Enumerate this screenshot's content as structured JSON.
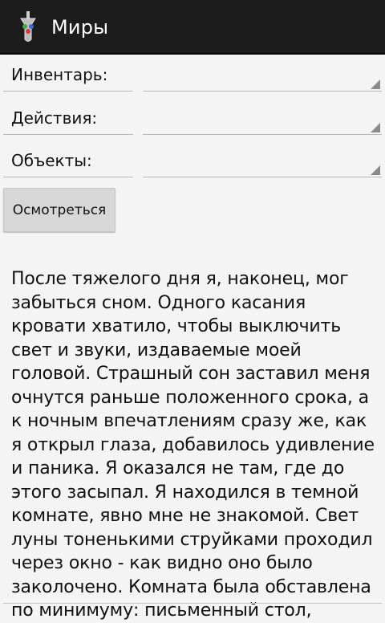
{
  "actionbar": {
    "title": "Миры",
    "icon": "app-potion-icon"
  },
  "controls": {
    "inventory_label": "Инвентарь:",
    "actions_label": "Действия:",
    "objects_label": "Объекты:",
    "inventory_value": "",
    "actions_value": "",
    "objects_value": ""
  },
  "look_button": "Осмотреться",
  "story_text": "После тяжелого дня я, наконец, мог забыться сном. Одного касания кровати хватило, чтобы выключить свет и звуки, издаваемые моей головой. Страшный сон заставил меня очнутся раньше положенного срока, а к ночным впечатлениям сразу же, как я открыл глаза, добавилось удивление и паника.  Я оказался не там, где до этого засыпал. Я находился в темной комнате, явно мне не знакомой. Свет луны тоненькими струйками проходил через окно - как видно оно было заколочено. Комната была обставлена по минимуму: письменный стол,",
  "colors": {
    "actionbar": "#1c1c1c",
    "background": "#f4f4f4",
    "button": "#d7d7d7"
  }
}
